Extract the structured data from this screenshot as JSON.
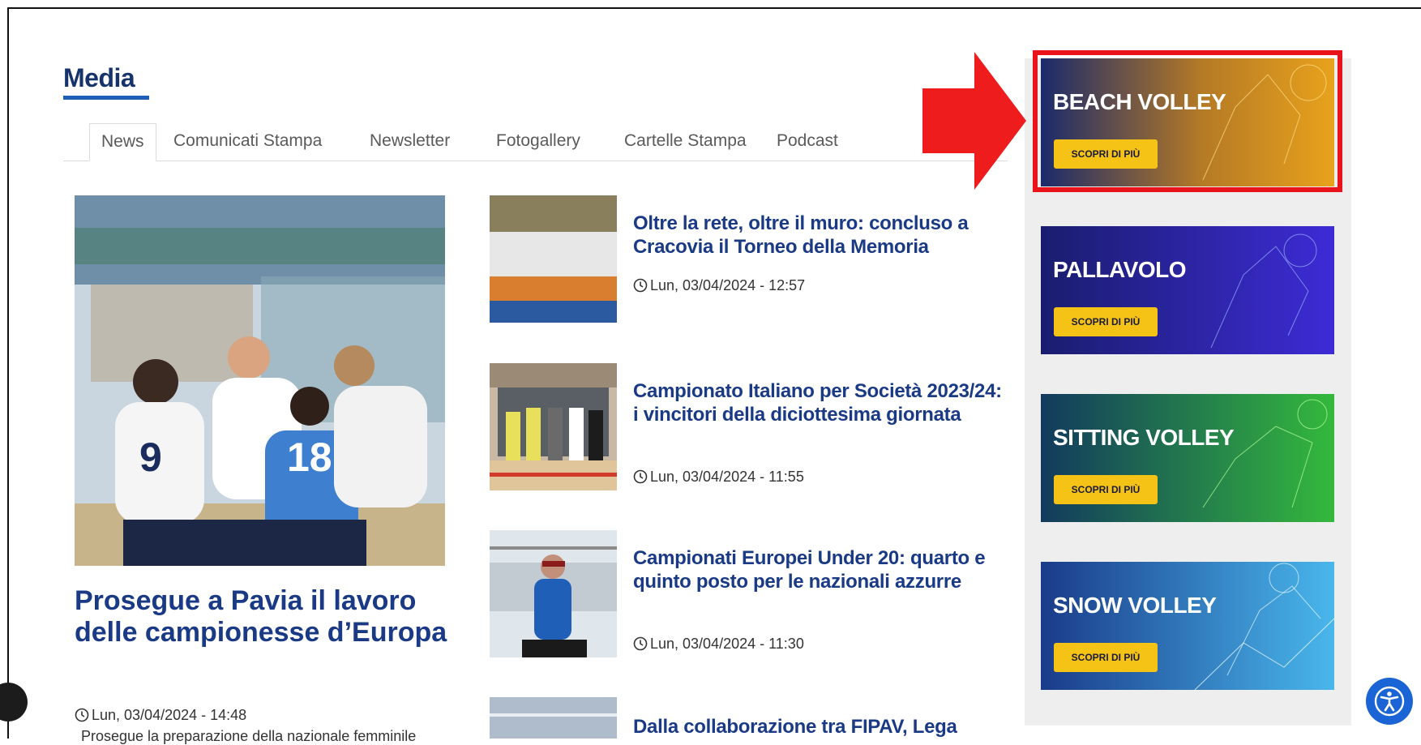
{
  "section": {
    "title": "Media"
  },
  "tabs": [
    "News",
    "Comunicati Stampa",
    "Newsletter",
    "Fotogallery",
    "Cartelle Stampa",
    "Podcast"
  ],
  "hero": {
    "title": "Prosegue a Pavia il lavoro delle campionesse d’Europa",
    "date": "Lun, 03/04/2024 - 14:48",
    "excerpt": "Prosegue la preparazione della nazionale femminile"
  },
  "news": [
    {
      "title": "Oltre la rete, oltre il muro: concluso a Cracovia il Torneo della Memoria",
      "date": "Lun, 03/04/2024 - 12:57"
    },
    {
      "title": "Campionato Italiano per Società 2023/24: i vincitori della diciottesima giornata",
      "date": "Lun, 03/04/2024 - 11:55"
    },
    {
      "title": "Campionati Europei Under 20: quarto e quinto posto per le nazionali azzurre",
      "date": "Lun, 03/04/2024 - 11:30"
    },
    {
      "title": "Dalla collaborazione tra FIPAV, Lega",
      "date": ""
    }
  ],
  "banners": [
    {
      "title": "BEACH VOLLEY",
      "button": "SCOPRI DI PIÙ",
      "color_a": "#1b2a6b",
      "color_b": "#e8a21c"
    },
    {
      "title": "PALLAVOLO",
      "button": "SCOPRI DI PIÙ",
      "color_a": "#1a1d6e",
      "color_b": "#3d2bd6"
    },
    {
      "title": "SITTING VOLLEY",
      "button": "SCOPRI DI PIÙ",
      "color_a": "#123a5e",
      "color_b": "#34b93c"
    },
    {
      "title": "SNOW VOLLEY",
      "button": "SCOPRI DI PIÙ",
      "color_a": "#1a3b8a",
      "color_b": "#49b7ec"
    }
  ],
  "colors": {
    "highlight": "#e8131b",
    "button": "#f4c315",
    "heading": "#1a3a86"
  }
}
